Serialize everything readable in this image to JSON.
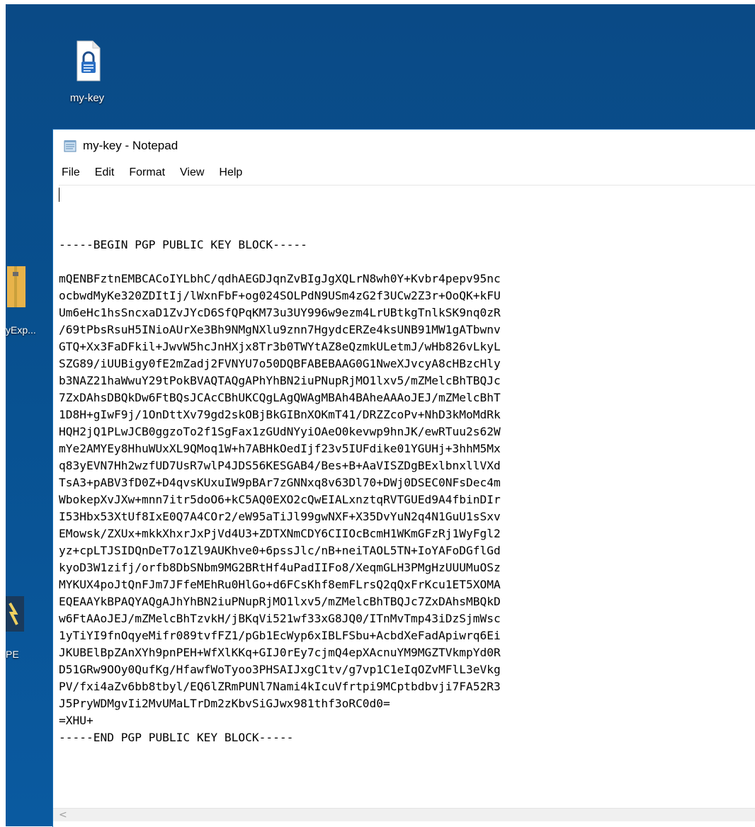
{
  "desktop": {
    "icons": [
      {
        "label": "my-key"
      },
      {
        "label": "yExp..."
      },
      {
        "label": "PE"
      }
    ]
  },
  "window": {
    "title": "my-key - Notepad",
    "menu": [
      "File",
      "Edit",
      "Format",
      "View",
      "Help"
    ],
    "lines": [
      "-----BEGIN PGP PUBLIC KEY BLOCK-----",
      "",
      "mQENBFztnEMBCACoIYLbhC/qdhAEGDJqnZvBIgJgXQLrN8wh0Y+Kvbr4pepv95nc",
      "ocbwdMyKe320ZDItIj/lWxnFbF+og024SOLPdN9USm4zG2f3UCw2Z3r+OoQK+kFU",
      "Um6eHc1hsSncxaD1ZvJYcD6SfQPqKM73u3UY996w9ezm4LrUBtkgTnlkSK9nq0zR",
      "/69tPbsRsuH5INioAUrXe3Bh9NMgNXlu9znn7HgydcERZe4ksUNB91MW1gATbwnv",
      "GTQ+Xx3FaDFkil+JwvW5hcJnHXjx8Tr3b0TWYtAZ8eQzmkULetmJ/wHb826vLkyL",
      "SZG89/iUUBigy0fE2mZadj2FVNYU7o50DQBFABEBAAG0G1NweXJvcyA8cHBzcHly",
      "b3NAZ21haWwuY29tPokBVAQTAQgAPhYhBN2iuPNupRjMO1lxv5/mZMelcBhTBQJc",
      "7ZxDAhsDBQkDw6FtBQsJCAcCBhUKCQgLAgQWAgMBAh4BAheAAAoJEJ/mZMelcBhT",
      "1D8H+gIwF9j/1OnDttXv79gd2skOBjBkGIBnXOKmT41/DRZZcoPv+NhD3kMoMdRk",
      "HQH2jQ1PLwJCB0ggzoTo2f1SgFax1zGUdNYyiOAeO0kevwp9hnJK/ewRTuu2s62W",
      "mYe2AMYEy8HhuWUxXL9QMoq1W+h7ABHkOedIjf23v5IUFdike01YGUHj+3hhM5Mx",
      "q83yEVN7Hh2wzfUD7UsR7wlP4JDS56KESGAB4/Bes+B+AaVISZDgBExlbnxllVXd",
      "TsA3+pABV3fD0Z+D4qvsKUxuIW9pBAr7zGNNxq8v63Dl70+DWj0DSEC0NFsDec4m",
      "WbokepXvJXw+mnn7itr5doO6+kC5AQ0EXO2cQwEIALxnztqRVTGUEd9A4fbinDIr",
      "I53Hbx53XtUf8IxE0Q7A4COr2/eW95aTiJl99gwNXF+X35DvYuN2q4N1GuU1sSxv",
      "EMowsk/ZXUx+mkkXhxrJxPjVd4U3+ZDTXNmCDY6CIIOcBcmH1WKmGFzRj1WyFgl2",
      "yz+cpLTJSIDQnDeT7o1Zl9AUKhve0+6pssJlc/nB+neiTAOL5TN+IoYAFoDGflGd",
      "kyoD3W1zifj/orfb8DbSNbm9MG2BRtHf4uPadIIFo8/XeqmGLH3PMgHzUUUMuOSz",
      "MYKUX4poJtQnFJm7JFfeMEhRu0HlGo+d6FCsKhf8emFLrsQ2qQxFrKcu1ET5XOMA",
      "EQEAAYkBPAQYAQgAJhYhBN2iuPNupRjMO1lxv5/mZMelcBhTBQJc7ZxDAhsMBQkD",
      "w6FtAAoJEJ/mZMelcBhTzvkH/jBKqVi521wf33xG8JQ0/ITnMvTmp43iDzSjmWsc",
      "1yTiYI9fnOqyeMifr089tvfFZ1/pGb1EcWyp6xIBLFSbu+AcbdXeFadApiwrq6Ei",
      "JKUBElBpZAnXYh9pnPEH+WfXlKKq+GIJ0rEy7cjmQ4epXAcnuYM9MGZTVkmpYd0R",
      "D51GRw9OOy0QufKg/HfawfWoTyoo3PHSAIJxgC1tv/g7vp1C1eIqOZvMFlL3eVkg",
      "PV/fxi4aZv6bb8tbyl/EQ6lZRmPUNl7Nami4kIcuVfrtpi9MCptbdbvji7FA52R3",
      "J5PryWDMgvIi2MvUMaLTrDm2zKbvSiGJwx981thf3oRC0d0=",
      "=XHU+",
      "-----END PGP PUBLIC KEY BLOCK-----"
    ]
  }
}
